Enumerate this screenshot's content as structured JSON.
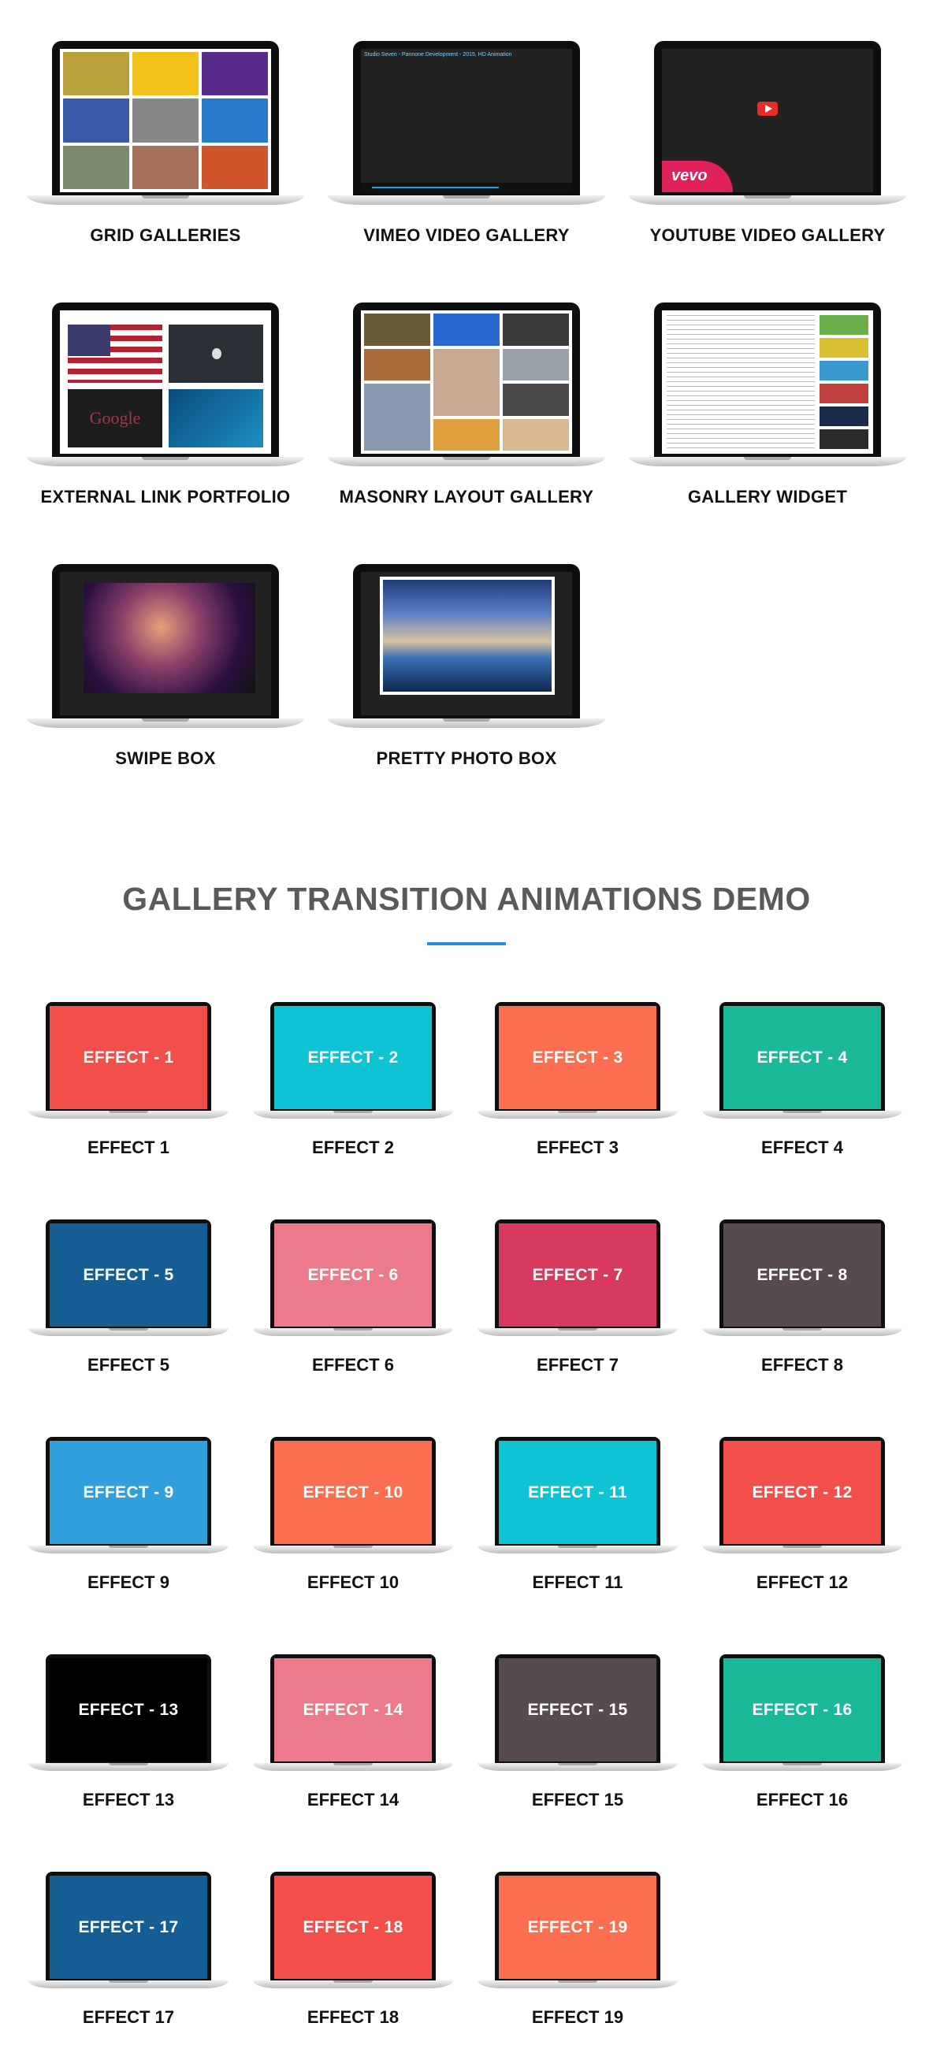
{
  "features": [
    {
      "label": "GRID GALLERIES"
    },
    {
      "label": "VIMEO VIDEO GALLERY",
      "screen_caption": "Studio Seven - Pannone Development - 2015, HD Animation"
    },
    {
      "label": "YOUTUBE VIDEO GALLERY",
      "logo_text": "vevo"
    },
    {
      "label": "EXTERNAL LINK PORTFOLIO",
      "logo_text": "Google"
    },
    {
      "label": "MASONRY LAYOUT GALLERY"
    },
    {
      "label": "GALLERY WIDGET"
    },
    {
      "label": "SWIPE BOX"
    },
    {
      "label": "PRETTY PHOTO BOX"
    }
  ],
  "section": {
    "title": "GALLERY TRANSITION ANIMATIONS DEMO",
    "accent_color": "#2b8ed8"
  },
  "effects": [
    {
      "screen": "EFFECT - 1",
      "label": "EFFECT 1",
      "color": "#f24f4a"
    },
    {
      "screen": "EFFECT - 2",
      "label": "EFFECT 2",
      "color": "#0ec4d4"
    },
    {
      "screen": "EFFECT - 3",
      "label": "EFFECT 3",
      "color": "#fb6e50"
    },
    {
      "screen": "EFFECT - 4",
      "label": "EFFECT 4",
      "color": "#19b99a"
    },
    {
      "screen": "EFFECT - 5",
      "label": "EFFECT 5",
      "color": "#145e93"
    },
    {
      "screen": "EFFECT - 6",
      "label": "EFFECT 6",
      "color": "#ec7a8a"
    },
    {
      "screen": "EFFECT - 7",
      "label": "EFFECT 7",
      "color": "#d73a5e"
    },
    {
      "screen": "EFFECT - 8",
      "label": "EFFECT 8",
      "color": "#574a50"
    },
    {
      "screen": "EFFECT - 9",
      "label": "EFFECT 9",
      "color": "#2fa0dc"
    },
    {
      "screen": "EFFECT - 10",
      "label": "EFFECT 10",
      "color": "#fb6e50"
    },
    {
      "screen": "EFFECT - 11",
      "label": "EFFECT 11",
      "color": "#0ec4d4"
    },
    {
      "screen": "EFFECT - 12",
      "label": "EFFECT 12",
      "color": "#f24f4a"
    },
    {
      "screen": "EFFECT - 13",
      "label": "EFFECT 13",
      "color": "#000000"
    },
    {
      "screen": "EFFECT - 14",
      "label": "EFFECT 14",
      "color": "#ec7a8a"
    },
    {
      "screen": "EFFECT - 15",
      "label": "EFFECT 15",
      "color": "#574a50"
    },
    {
      "screen": "EFFECT - 16",
      "label": "EFFECT 16",
      "color": "#19b99a"
    },
    {
      "screen": "EFFECT - 17",
      "label": "EFFECT 17",
      "color": "#145e93"
    },
    {
      "screen": "EFFECT - 18",
      "label": "EFFECT 18",
      "color": "#f24f4a"
    },
    {
      "screen": "EFFECT - 19",
      "label": "EFFECT 19",
      "color": "#fb6e50"
    }
  ]
}
